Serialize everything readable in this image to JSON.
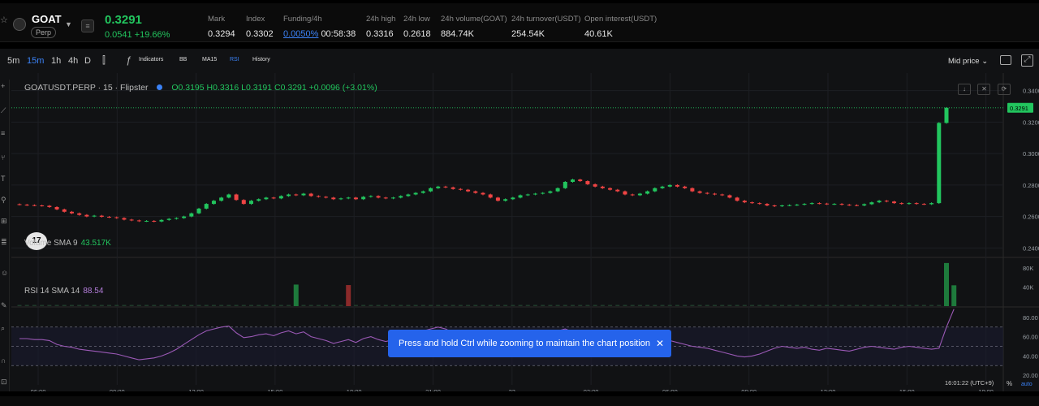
{
  "header": {
    "symbol": "GOAT",
    "market_tag": "Perp",
    "last_price": "0.3291",
    "change": "0.0541 +19.66%",
    "stats": [
      {
        "key": "Mark",
        "value": "0.3294"
      },
      {
        "key": "Index",
        "value": "0.3302"
      },
      {
        "key": "Funding/4h",
        "link": "0.0050%",
        "value": "00:58:38"
      },
      {
        "key": "24h high",
        "value": "0.3316"
      },
      {
        "key": "24h low",
        "value": "0.2618"
      },
      {
        "key": "24h volume(GOAT)",
        "value": "884.74K"
      },
      {
        "key": "24h turnover(USDT)",
        "value": "254.54K"
      },
      {
        "key": "Open interest(USDT)",
        "value": "40.61K"
      }
    ],
    "up_color": "#22c55e"
  },
  "toolbar": {
    "timeframes": [
      "5m",
      "15m",
      "1h",
      "4h",
      "D"
    ],
    "active_timeframe": "15m",
    "indicators_label": "Indicators",
    "ind_bb": "BB",
    "ind_ma": "MA15",
    "ind_rsi": "RSI",
    "history_label": "History",
    "mid_price_label": "Mid price"
  },
  "legend": {
    "title": "GOATUSDT.PERP · 15 · Flipster",
    "ohlc": "O0.3195 H0.3316 L0.3191 C0.3291 +0.0096 (+3.01%)",
    "volume_label": "Volume SMA 9",
    "volume_value": "43.517K",
    "rsi_label": "RSI 14 SMA 14",
    "rsi_value": "88.54"
  },
  "tv_logo": "17",
  "price_axis": {
    "ticks": [
      "0.3400",
      "0.3200",
      "0.3000",
      "0.2800",
      "0.2600",
      "0.2400"
    ],
    "current": "0.3291"
  },
  "volume_axis": {
    "ticks": [
      "80K",
      "40K"
    ]
  },
  "rsi_axis": {
    "ticks": [
      "80.00",
      "60.00",
      "40.00",
      "20.00"
    ]
  },
  "time_axis": {
    "labels": [
      "06:00",
      "09:00",
      "12:00",
      "15:00",
      "18:00",
      "21:00",
      "23",
      "03:00",
      "06:00",
      "09:00",
      "12:00",
      "15:00",
      "18:00"
    ],
    "clock": "16:01:22 (UTC+9)",
    "pct": "%",
    "auto": "auto"
  },
  "toast": {
    "text": "Press and hold Ctrl while zooming to maintain the chart position"
  },
  "colors": {
    "up": "#22c55e",
    "down": "#ef4444",
    "rsi": "#9b59b6",
    "accent": "#3b82f6"
  },
  "chart_data": {
    "type": "candlestick",
    "interval": "15m",
    "price_ylim": [
      0.235,
      0.345
    ],
    "closes": [
      0.2675,
      0.2672,
      0.267,
      0.2668,
      0.266,
      0.2645,
      0.263,
      0.262,
      0.261,
      0.26,
      0.2605,
      0.2598,
      0.2595,
      0.259,
      0.258,
      0.2575,
      0.257,
      0.2572,
      0.2568,
      0.2578,
      0.2585,
      0.259,
      0.26,
      0.262,
      0.265,
      0.268,
      0.27,
      0.272,
      0.274,
      0.2705,
      0.268,
      0.27,
      0.271,
      0.272,
      0.2715,
      0.273,
      0.274,
      0.2735,
      0.2745,
      0.273,
      0.2725,
      0.272,
      0.271,
      0.2715,
      0.272,
      0.271,
      0.2725,
      0.273,
      0.272,
      0.2715,
      0.272,
      0.273,
      0.274,
      0.275,
      0.276,
      0.278,
      0.279,
      0.2785,
      0.2775,
      0.277,
      0.276,
      0.275,
      0.274,
      0.272,
      0.27,
      0.271,
      0.272,
      0.2735,
      0.274,
      0.2745,
      0.275,
      0.276,
      0.278,
      0.282,
      0.2835,
      0.2825,
      0.2805,
      0.279,
      0.278,
      0.277,
      0.276,
      0.274,
      0.2735,
      0.2745,
      0.276,
      0.278,
      0.279,
      0.28,
      0.279,
      0.278,
      0.276,
      0.275,
      0.2745,
      0.274,
      0.2735,
      0.272,
      0.27,
      0.269,
      0.2685,
      0.268,
      0.267,
      0.2665,
      0.267,
      0.2672,
      0.2675,
      0.268,
      0.2685,
      0.2682,
      0.2678,
      0.268,
      0.2675,
      0.2672,
      0.267,
      0.2678,
      0.269,
      0.27,
      0.2695,
      0.2685,
      0.268,
      0.2685,
      0.268,
      0.2678,
      0.2685,
      0.3195,
      0.3291
    ],
    "volume_ylim": [
      0,
      100000
    ],
    "volume_bars": [
      {
        "index": 37,
        "value": 45000,
        "dir": "up"
      },
      {
        "index": 44,
        "value": 44000,
        "dir": "down"
      },
      {
        "index": 124,
        "value": 90000,
        "dir": "up"
      },
      {
        "index": 125,
        "value": 43500,
        "dir": "up"
      }
    ],
    "rsi_ylim": [
      10,
      90
    ],
    "rsi_levels": [
      70,
      50,
      30
    ],
    "rsi": [
      58,
      58,
      57,
      57,
      56,
      52,
      50,
      49,
      47,
      46,
      45,
      44,
      43,
      42,
      40,
      38,
      36,
      37,
      38,
      40,
      43,
      47,
      52,
      57,
      62,
      66,
      68,
      70,
      71,
      64,
      59,
      60,
      62,
      63,
      61,
      64,
      66,
      63,
      65,
      60,
      58,
      56,
      53,
      55,
      57,
      54,
      58,
      60,
      57,
      55,
      57,
      60,
      62,
      64,
      66,
      68,
      70,
      68,
      64,
      61,
      58,
      55,
      52,
      50,
      48,
      50,
      53,
      56,
      58,
      60,
      62,
      64,
      66,
      68,
      65,
      60,
      55,
      53,
      51,
      50,
      48,
      46,
      45,
      48,
      50,
      53,
      55,
      56,
      54,
      52,
      50,
      49,
      48,
      46,
      44,
      42,
      40,
      39,
      40,
      42,
      45,
      48,
      50,
      49,
      48,
      49,
      47,
      46,
      48,
      47,
      46,
      45,
      47,
      49,
      50,
      49,
      48,
      47,
      49,
      50,
      49,
      48,
      47,
      48,
      70,
      88.54
    ]
  }
}
